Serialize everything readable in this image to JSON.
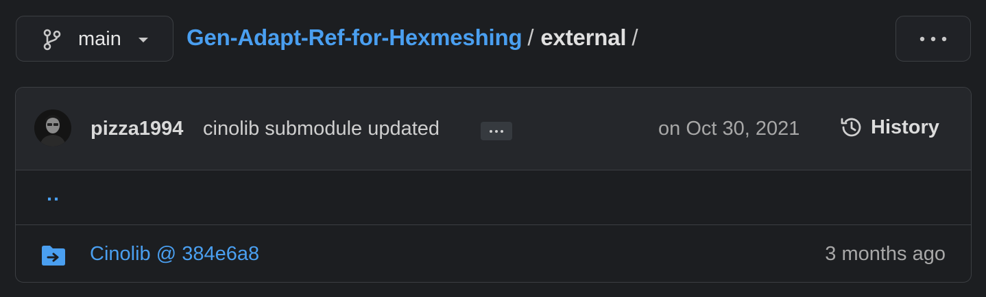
{
  "branch": {
    "name": "main",
    "icon": "git-branch-icon"
  },
  "breadcrumb": {
    "repo": "Gen-Adapt-Ref-for-Hexmeshing",
    "separator": "/",
    "current": "external",
    "trailing_separator": "/"
  },
  "more_button": {
    "icon": "kebab-horizontal-icon"
  },
  "commit": {
    "author": "pizza1994",
    "message": "cinolib submodule updated",
    "ellipsis": "…",
    "date": "on Oct 30, 2021",
    "history_label": "History"
  },
  "parent_dir": {
    "label": ".."
  },
  "files": [
    {
      "name": "Cinolib @ 384e6a8",
      "age": "3 months ago",
      "icon": "submodule-folder-icon"
    }
  ],
  "colors": {
    "background": "#1c1e21",
    "link": "#4a9ff0",
    "border": "#3c3f43",
    "header_row": "#25272b"
  }
}
